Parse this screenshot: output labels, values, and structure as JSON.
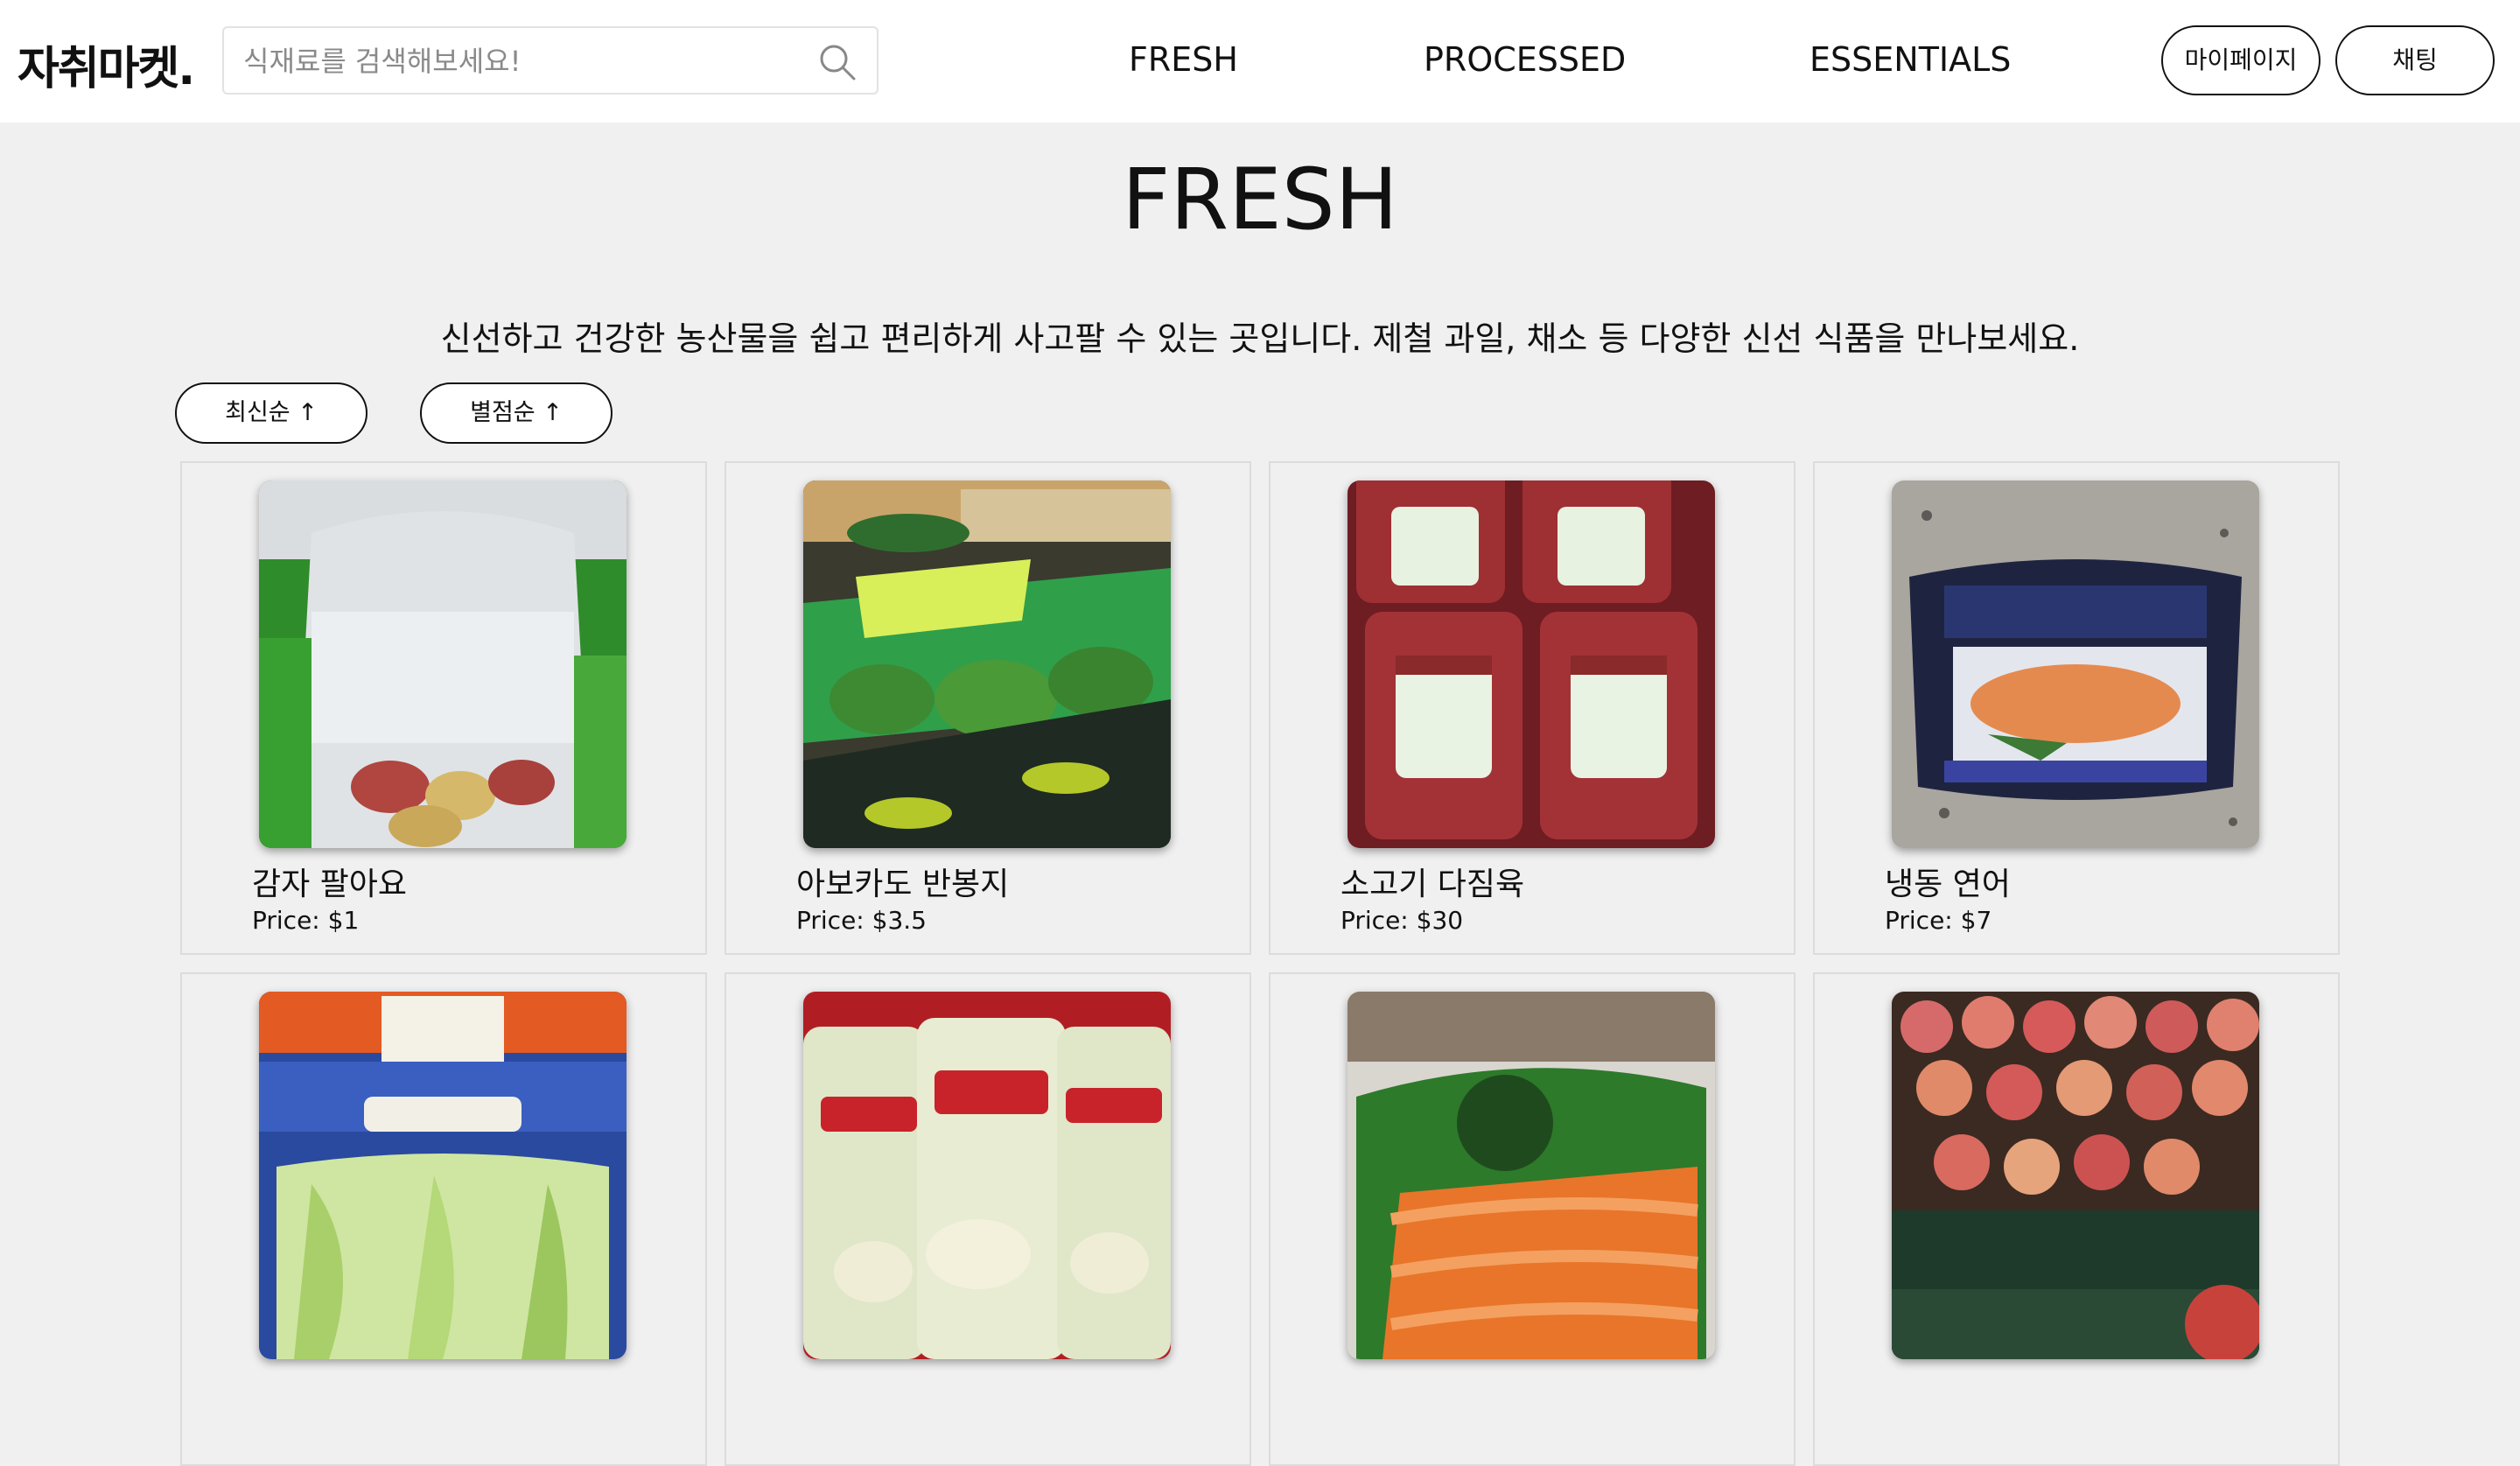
{
  "header": {
    "logo": "자취마켓.",
    "search": {
      "placeholder": "식재료를 검색해보세요!",
      "value": ""
    },
    "nav": [
      "FRESH",
      "PROCESSED",
      "ESSENTIALS"
    ],
    "mypage_label": "마이페이지",
    "chat_label": "채팅"
  },
  "main": {
    "title": "FRESH",
    "description": "신선하고 건강한 농산물을 쉽고 편리하게 사고팔 수 있는 곳입니다. 제철 과일, 채소 등 다양한 신선 식품을 만나보세요.",
    "sort_buttons": [
      "최신순 ↑",
      "별점순 ↑"
    ],
    "price_prefix": "Price: ",
    "products": [
      {
        "title": "감자 팔아요",
        "price": "Price: $1",
        "image": "potato-bag-image"
      },
      {
        "title": "아보카도 반봉지",
        "price": "Price: $3.5",
        "image": "avocado-bag-image"
      },
      {
        "title": "소고기 다짐육",
        "price": "Price: $30",
        "image": "ground-beef-image"
      },
      {
        "title": "냉동 연어",
        "price": "Price: $7",
        "image": "frozen-salmon-image"
      },
      {
        "title": "",
        "price": "",
        "image": "romaine-lettuce-image"
      },
      {
        "title": "",
        "price": "",
        "image": "peeled-garlic-image"
      },
      {
        "title": "",
        "price": "",
        "image": "carrot-bag-image"
      },
      {
        "title": "",
        "price": "",
        "image": "apples-image"
      }
    ]
  },
  "colors": {
    "background": "#f0f0f0",
    "header_bg": "#ffffff",
    "text": "#111111",
    "card_border": "#dcdcdc"
  }
}
